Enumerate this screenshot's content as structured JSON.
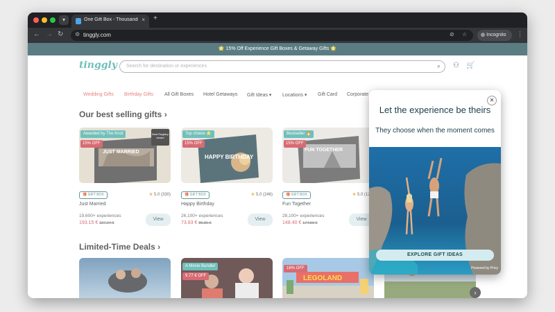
{
  "browser": {
    "tab_title": "One Gift Box - Thousands of",
    "url": "tinggly.com",
    "incognito_label": "Incognito",
    "new_tab_symbol": "+",
    "tab_close_symbol": "×"
  },
  "promo_banner": "🌟 15% Off Experience Gift Boxes & Getaway Gifts 🌟",
  "header": {
    "logo": "tinggly",
    "search_placeholder": "Search for destination or experiences"
  },
  "nav": [
    {
      "label": "Wedding Gifts",
      "color": "#d9534f"
    },
    {
      "label": "Birthday Gifts",
      "color": "#d9534f"
    },
    {
      "label": "All Gift Boxes",
      "color": "#222222"
    },
    {
      "label": "Hotel Getaways",
      "color": "#222222"
    },
    {
      "label": "Gift Ideas ▾",
      "color": "#222222"
    },
    {
      "label": "Locations ▾",
      "color": "#222222"
    },
    {
      "label": "Gift Card",
      "color": "#222222"
    },
    {
      "label": "Corporate",
      "color": "#222222"
    }
  ],
  "best_selling": {
    "title": "Our best selling gifts",
    "chevron": "›",
    "cards": [
      {
        "badge": "Awarded by The Knot",
        "discount": "15% OFF",
        "box_title": "JUST MARRIED",
        "type": "GIFT BOX",
        "rating": "5.0",
        "reviews": "(330)",
        "name": "Just Married",
        "experiences": "19,600+ experiences",
        "price": "193.15 €",
        "old_price": "227.24 €",
        "view": "View",
        "award": "Best Registry Award"
      },
      {
        "badge": "Top choice ⭐",
        "discount": "15% OFF",
        "box_title": "HAPPY BIRTHDAY",
        "type": "GIFT BOX",
        "rating": "5.0",
        "reviews": "(246)",
        "name": "Happy Birthday",
        "experiences": "26,100+ experiences",
        "price": "73.83 €",
        "old_price": "86.86 €",
        "view": "View"
      },
      {
        "badge": "Bestseller 🔥",
        "discount": "15% OFF",
        "box_title": "FUN TOGETHER",
        "type": "GIFT BOX",
        "rating": "5.0",
        "reviews": "(129)",
        "name": "Fun Together",
        "experiences": "28,100+ experiences",
        "price": "148.40 €",
        "old_price": "174.59 €",
        "view": "View"
      }
    ]
  },
  "deals": {
    "title": "Limited-Time Deals",
    "chevron": "›",
    "items": [
      {
        "badge": "",
        "discount": ""
      },
      {
        "badge": "A Movie Bundle!",
        "discount": "9.77 € OFF"
      },
      {
        "badge": "",
        "discount": "16% OFF",
        "brand": "LEGOLAND"
      },
      {
        "badge": "",
        "discount": ""
      }
    ]
  },
  "modal": {
    "headline": "Let the experience be theirs",
    "subheadline": "They choose when the moment comes",
    "cta": "EXPLORE GIFT IDEAS",
    "powered": "Powered by Privy"
  },
  "colors": {
    "accent": "#3aa8a0",
    "dark": "#1b4a53",
    "sale": "#c8333f"
  },
  "icons": {
    "search": "search-icon",
    "user": "user-icon",
    "cart": "cart-icon",
    "chat": "chat-icon",
    "close": "close-icon"
  }
}
